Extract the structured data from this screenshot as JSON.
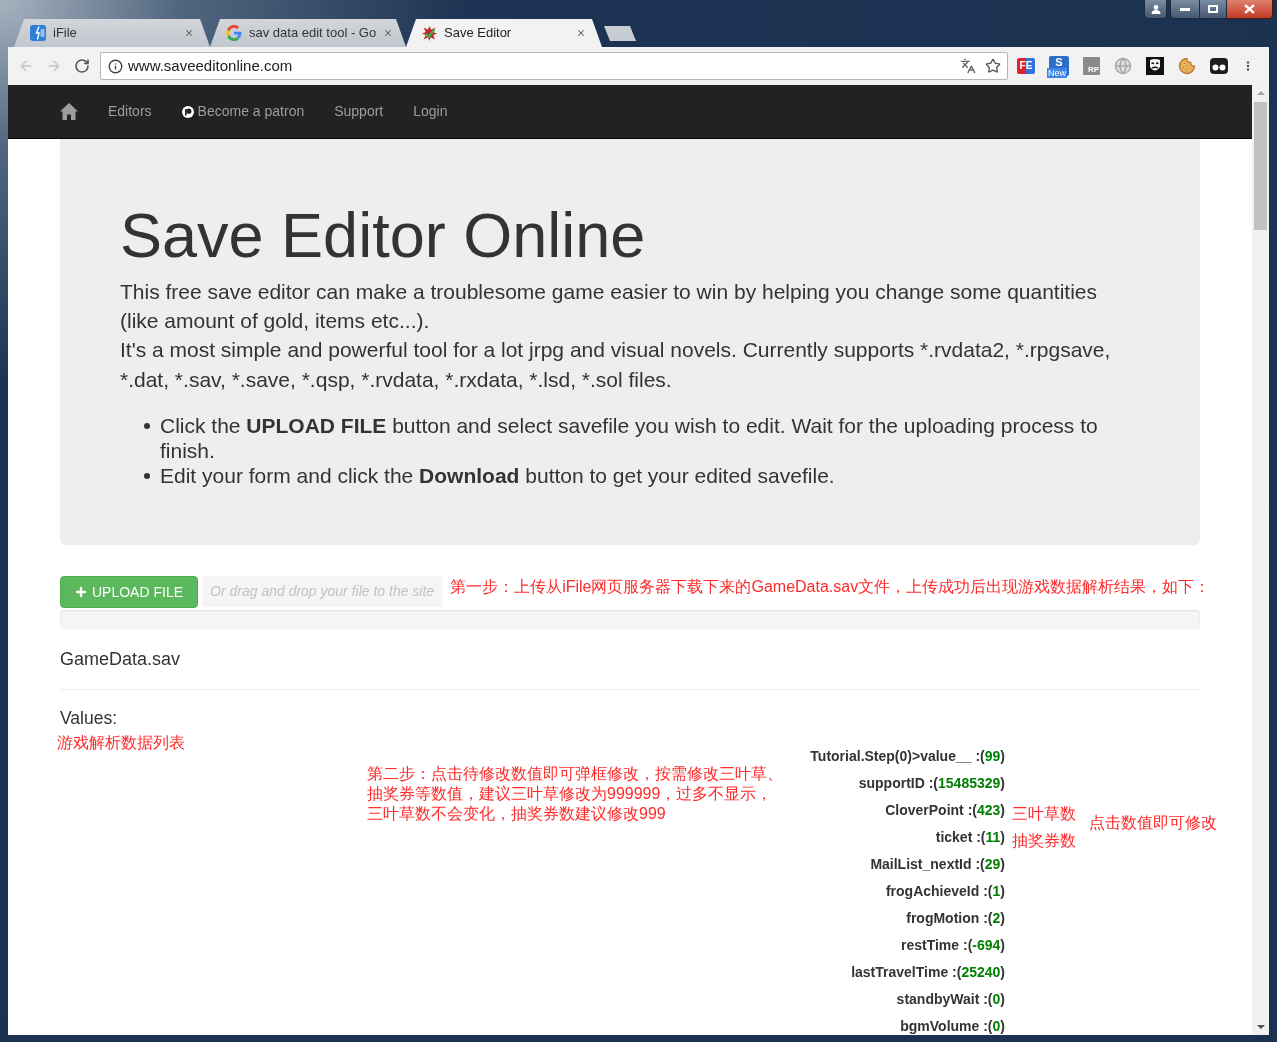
{
  "tabs": [
    {
      "title": "iFile",
      "selected": false
    },
    {
      "title": "sav data edit tool - Go",
      "selected": false
    },
    {
      "title": "Save Editor",
      "selected": true
    }
  ],
  "address_bar": {
    "url": "www.saveeditonline.com"
  },
  "extensions": [
    {
      "text": "FE"
    },
    {
      "text": "S",
      "badge": "New"
    },
    {
      "text": "RP"
    }
  ],
  "navbar": {
    "items": [
      {
        "label": "Editors",
        "kind": "link"
      },
      {
        "label": "Become a patron",
        "kind": "patron"
      },
      {
        "label": "Support",
        "kind": "link"
      },
      {
        "label": "Login",
        "kind": "link"
      }
    ]
  },
  "hero": {
    "title": "Save Editor Online",
    "paragraphs": [
      "This free save editor can make a troublesome game easier to win by helping you change some quantities (like amount of gold, items etc...).",
      "It's a most simple and powerful tool for a lot jrpg and visual novels. Currently supports *.rvdata2, *.rpgsave, *.dat, *.sav, *.save, *.qsp, *.rvdata, *.rxdata, *.lsd, *.sol files."
    ],
    "steps": [
      "Click the **UPLOAD FILE** button and select savefile you wish to edit. Wait for the uploading process to finish.",
      "Edit your form and click the **Download** button to get your edited savefile."
    ]
  },
  "upload": {
    "button": "UPLOAD FILE",
    "drop_hint": "Or drag and drop your file to the site",
    "annotation": "第一步：上传从iFile网页服务器下载下来的GameData.sav文件，上传成功后出现游戏数据解析结果，如下："
  },
  "file": {
    "name": "GameData.sav"
  },
  "values": {
    "heading": "Values:",
    "annotation": "游戏解析数据列表",
    "instructions": [
      "第二步：点击待修改数值即可弹框修改，按需修改三叶草、",
      "抽奖券等数值，建议三叶草修改为999999，过多不显示，",
      "三叶草数不会变化，抽奖券数建议修改999"
    ],
    "click_hint": "点击数值即可修改",
    "rows": [
      {
        "label": "Tutorial.Step(0)>value__ :(",
        "value": "99",
        "close": ")"
      },
      {
        "label": "supportID :(",
        "value": "15485329",
        "close": ")"
      },
      {
        "label": "CloverPoint :(",
        "value": "423",
        "close": ")",
        "note": "三叶草数"
      },
      {
        "label": "ticket :(",
        "value": "11",
        "close": ")",
        "note": "抽奖券数"
      },
      {
        "label": "MailList_nextId :(",
        "value": "29",
        "close": ")"
      },
      {
        "label": "frogAchieveId :(",
        "value": "1",
        "close": ")"
      },
      {
        "label": "frogMotion :(",
        "value": "2",
        "close": ")"
      },
      {
        "label": "restTime :(",
        "value": "-694",
        "close": ")"
      },
      {
        "label": "lastTravelTime :(",
        "value": "25240",
        "close": ")"
      },
      {
        "label": "standbyWait :(",
        "value": "0",
        "close": ")"
      },
      {
        "label": "bgmVolume :(",
        "value": "0",
        "close": ")"
      }
    ]
  }
}
